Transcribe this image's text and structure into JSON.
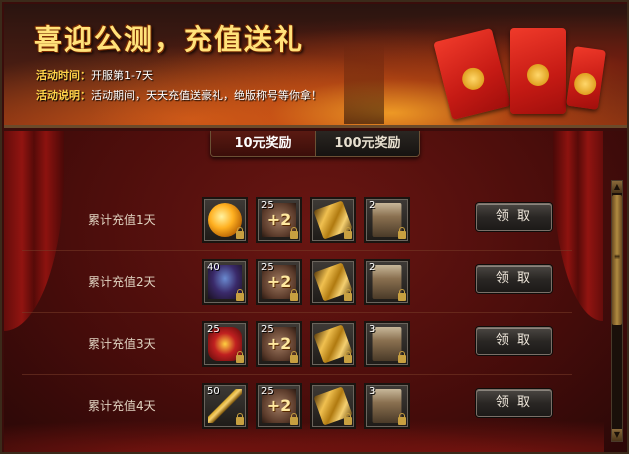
{
  "banner": {
    "title": "喜迎公测，充值送礼",
    "time_label": "活动时间：",
    "time_value": "开服第1-7天",
    "desc_label": "活动说明：",
    "desc_value": "活动期间，天天充值送豪礼，绝版称号等你拿！"
  },
  "tabs": [
    {
      "label": "10元奖励",
      "active": true
    },
    {
      "label": "100元奖励",
      "active": false
    }
  ],
  "rows": [
    {
      "label": "累计充值1天",
      "items": [
        {
          "icon": "golden-orb-icon",
          "count": ""
        },
        {
          "icon": "plus-two-icon",
          "count": "25"
        },
        {
          "icon": "gold-scroll-icon",
          "count": ""
        },
        {
          "icon": "old-scroll-icon",
          "count": "2"
        }
      ],
      "button": "领 取"
    },
    {
      "label": "累计充值2天",
      "items": [
        {
          "icon": "warrior-figure-icon",
          "count": "40"
        },
        {
          "icon": "plus-two-icon",
          "count": "25"
        },
        {
          "icon": "gold-scroll-icon",
          "count": ""
        },
        {
          "icon": "old-scroll-icon",
          "count": "2"
        }
      ],
      "button": "领 取"
    },
    {
      "label": "累计充值3天",
      "items": [
        {
          "icon": "medal-icon",
          "count": "25"
        },
        {
          "icon": "plus-two-icon",
          "count": "25"
        },
        {
          "icon": "gold-scroll-icon",
          "count": ""
        },
        {
          "icon": "old-scroll-icon",
          "count": "3"
        }
      ],
      "button": "领 取"
    },
    {
      "label": "累计充值4天",
      "items": [
        {
          "icon": "golden-spear-icon",
          "count": "50"
        },
        {
          "icon": "plus-two-icon",
          "count": "25"
        },
        {
          "icon": "gold-scroll-icon",
          "count": ""
        },
        {
          "icon": "old-scroll-icon",
          "count": "3"
        }
      ],
      "button": "领 取"
    }
  ],
  "item_glyphs": {
    "plus_two": "+2"
  },
  "scrollbar": {
    "up": "▲",
    "down": "▼",
    "grip": "≡"
  },
  "colors": {
    "title_gold": "#ffe27a",
    "label_gold": "#ffd24a",
    "panel_red": "#4a0d0b"
  }
}
